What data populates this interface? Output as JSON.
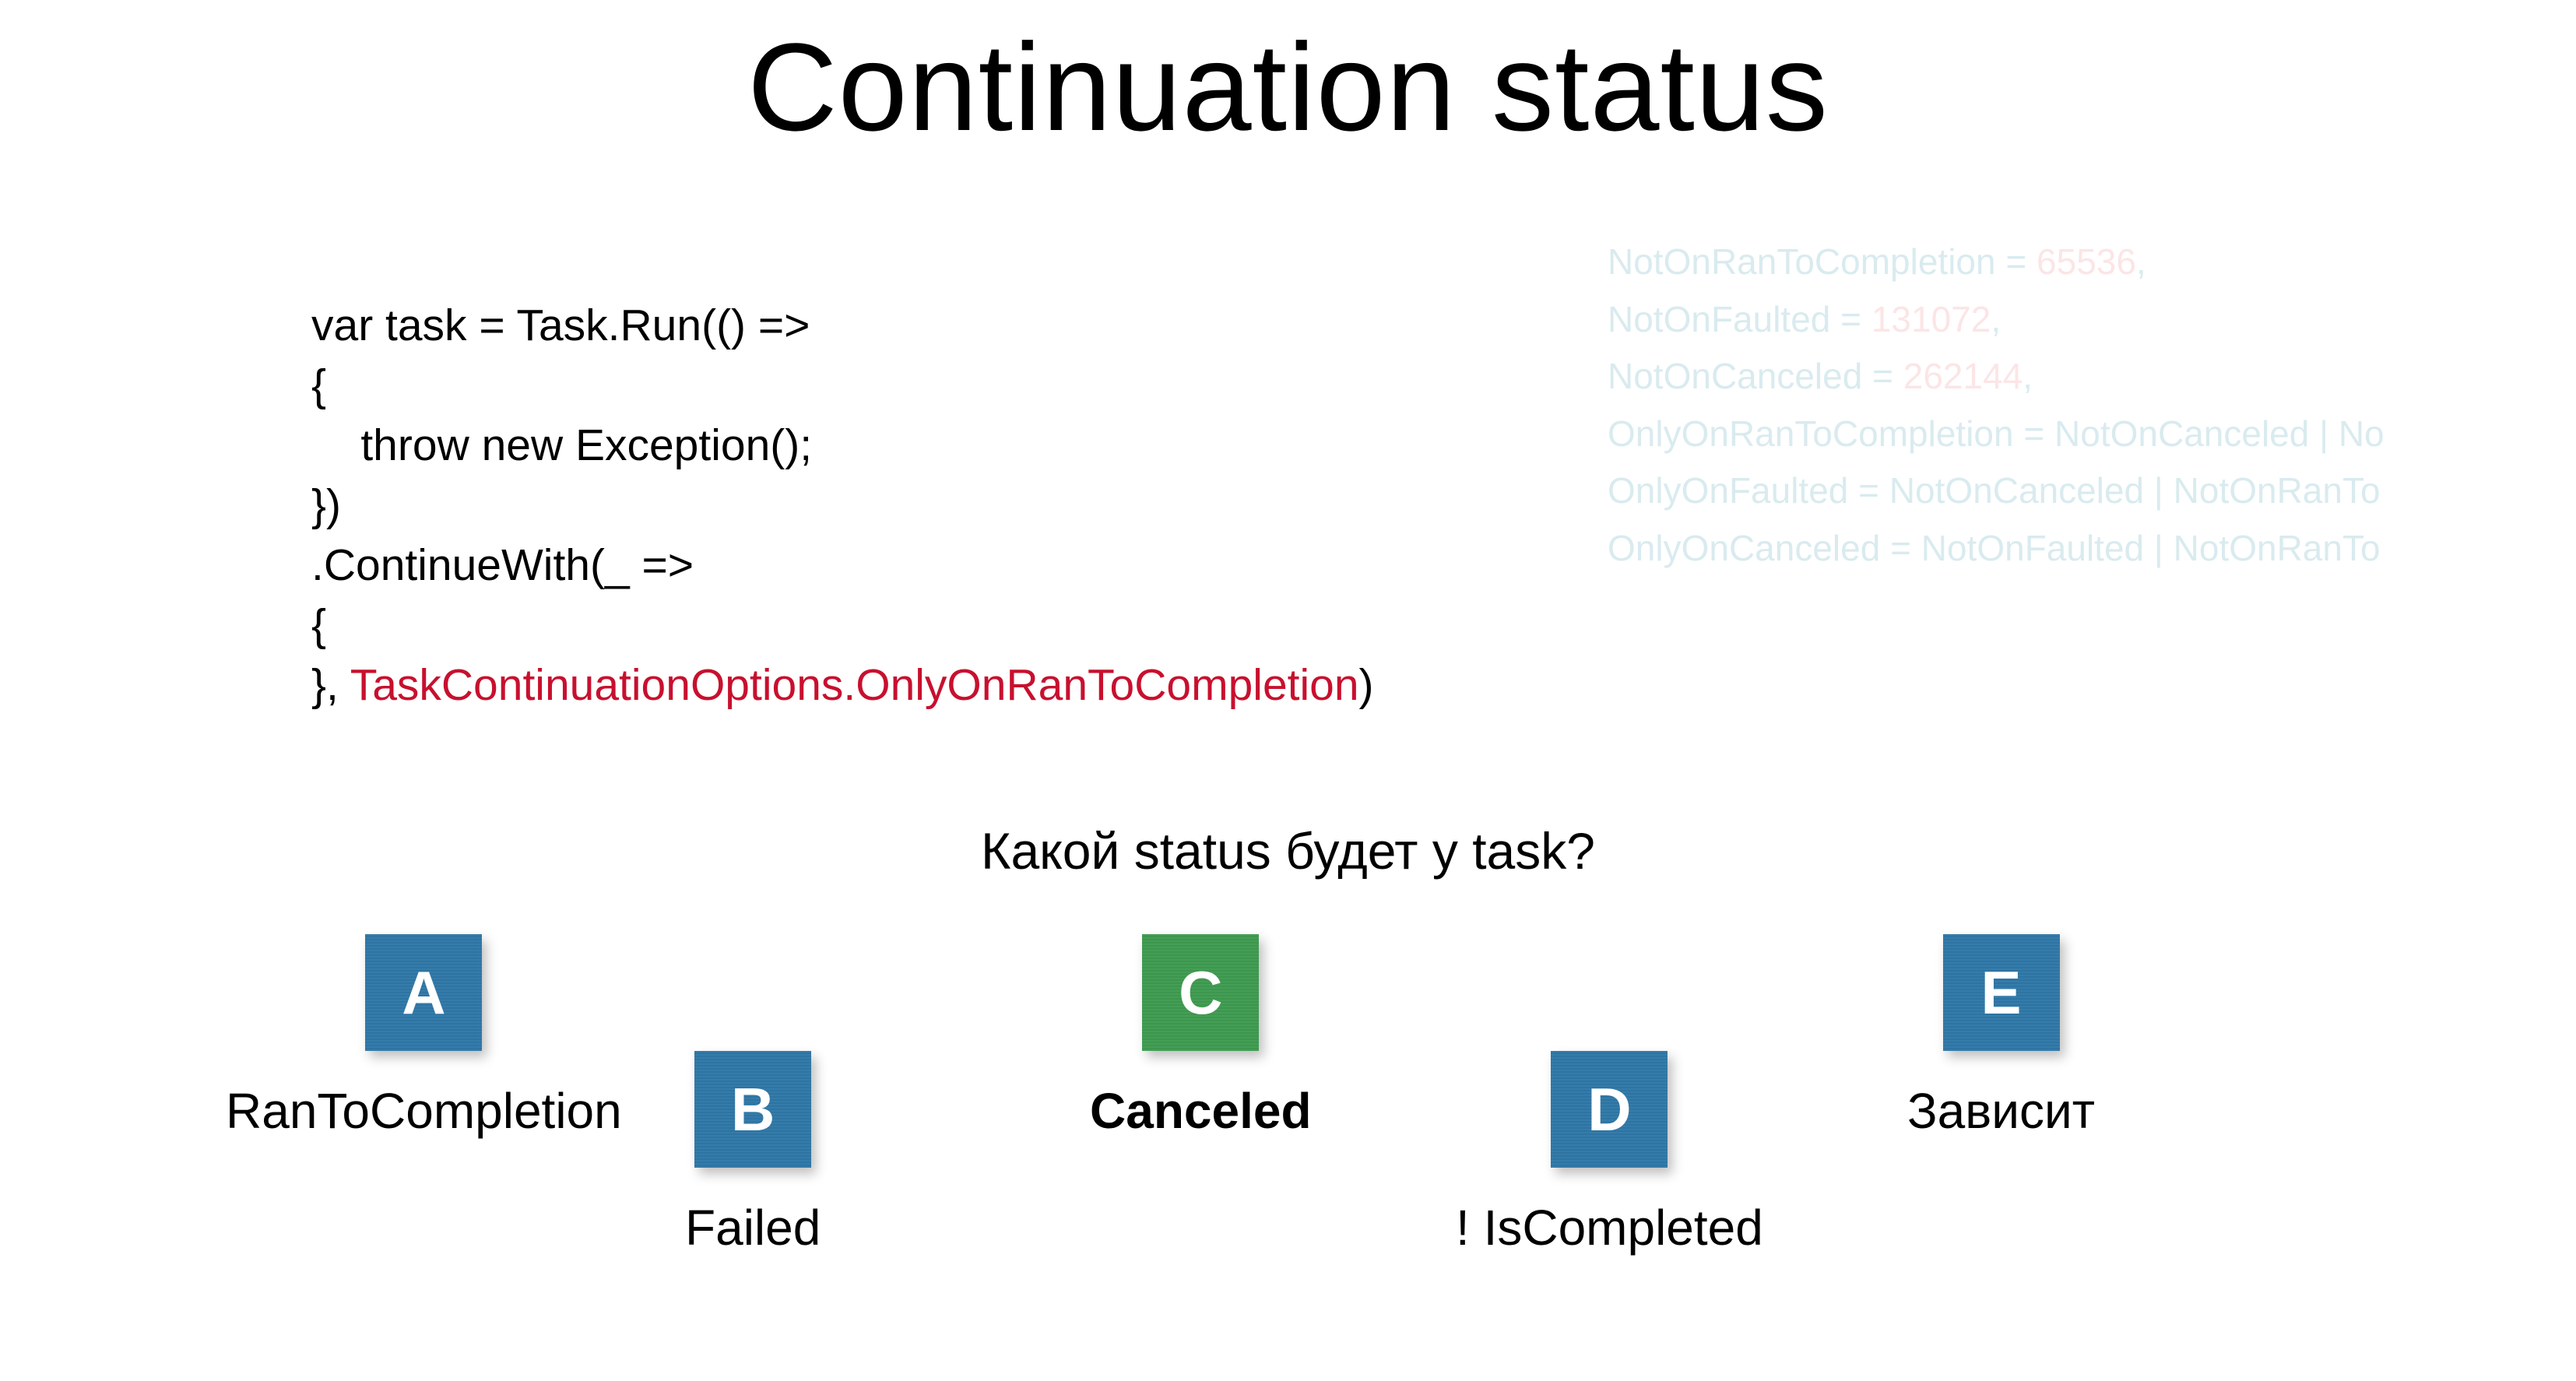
{
  "title": "Continuation status",
  "code": {
    "line1": "var task = Task.Run(() =>",
    "line2": "{",
    "line3": "    throw new Exception();",
    "line4": "})",
    "line5": ".ContinueWith(_ =>",
    "line6": "{",
    "line7_prefix": "}, ",
    "line7_red": "TaskContinuationOptions.OnlyOnRanToCompletion",
    "line7_suffix": ")"
  },
  "enum": {
    "l1a": "NotOnRanToCompletion",
    "l1b": " = ",
    "l1c": "65536",
    "l1d": ",",
    "l2a": "NotOnFaulted",
    "l2b": " = ",
    "l2c": "131072",
    "l2d": ",",
    "l3a": "NotOnCanceled",
    "l3b": " = ",
    "l3c": "262144",
    "l3d": ",",
    "l4a": "OnlyOnRanToCompletion",
    "l4b": " = ",
    "l4c": "NotOnCanceled | No",
    "l5a": "OnlyOnFaulted",
    "l5b": " = ",
    "l5c": "NotOnCanceled | NotOnRanTo",
    "l6a": "OnlyOnCanceled",
    "l6b": " = ",
    "l6c": "NotOnFaulted | NotOnRanTo"
  },
  "question": "Какой status будет у task?",
  "options": {
    "a": {
      "letter": "A",
      "label": "RanToCompletion"
    },
    "b": {
      "letter": "B",
      "label": "Failed"
    },
    "c": {
      "letter": "C",
      "label": "Canceled"
    },
    "d": {
      "letter": "D",
      "label": "! IsCompleted"
    },
    "e": {
      "letter": "E",
      "label": "Зависит"
    }
  }
}
